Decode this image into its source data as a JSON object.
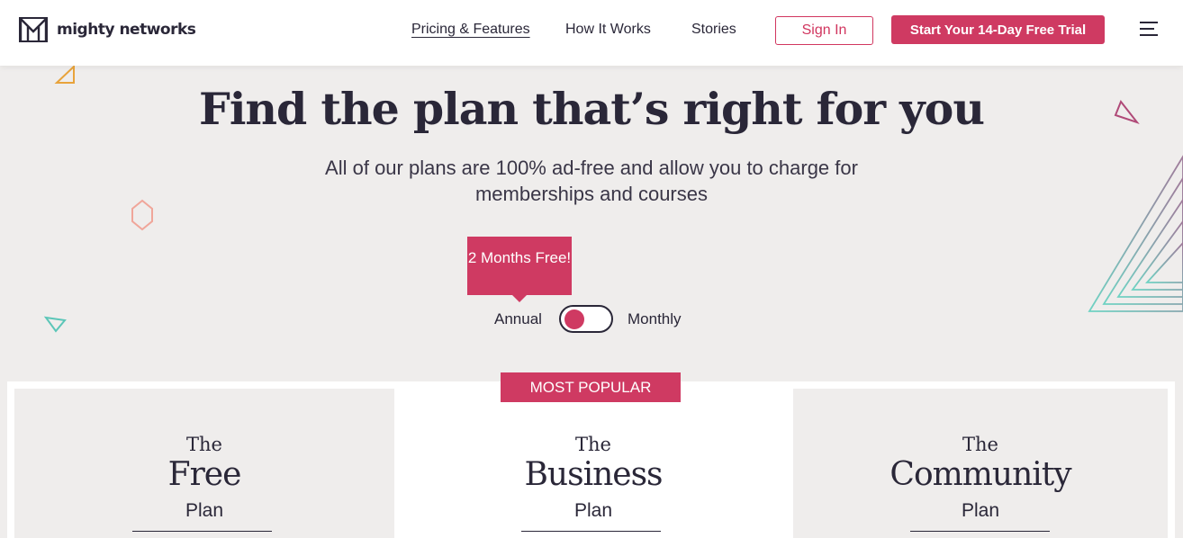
{
  "header": {
    "brand": "mighty networks",
    "nav": [
      "Pricing & Features",
      "How It Works",
      "Stories"
    ],
    "sign_in": "Sign In",
    "trial_cta": "Start Your 14-Day Free Trial"
  },
  "hero": {
    "title": "Find the plan that’s right for you",
    "subtitle": "All of our plans are 100% ad-free and allow you to charge for memberships and courses"
  },
  "billing": {
    "badge": "2 Months Free!",
    "annual": "Annual",
    "monthly": "Monthly",
    "selected": "Annual"
  },
  "plans": {
    "popular_label": "MOST POPULAR",
    "items": [
      {
        "prefix": "The",
        "name": "Free",
        "suffix": "Plan"
      },
      {
        "prefix": "The",
        "name": "Business",
        "suffix": "Plan"
      },
      {
        "prefix": "The",
        "name": "Community",
        "suffix": "Plan"
      }
    ]
  },
  "colors": {
    "accent": "#cf3a62",
    "text": "#2a2738",
    "background": "#efedec"
  }
}
